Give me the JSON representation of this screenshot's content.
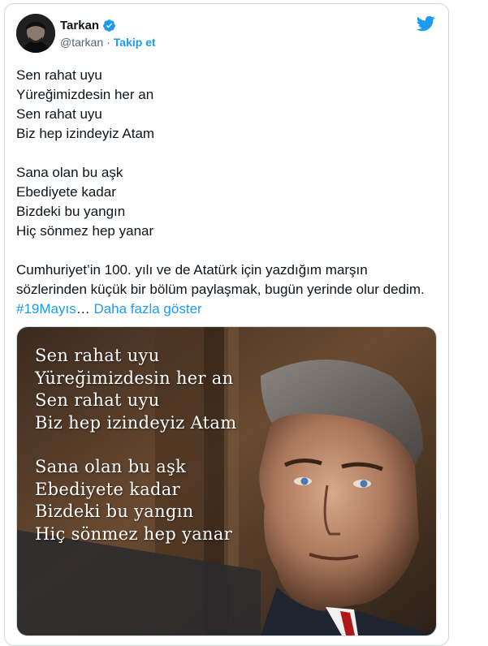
{
  "tweet": {
    "author": {
      "name": "Tarkan",
      "handle": "@tarkan",
      "separator": "·",
      "follow_label": "Takip et",
      "verified": true
    },
    "body": {
      "stanza1": [
        "Sen rahat uyu",
        "Yüreğimizdesin her an",
        "Sen rahat uyu",
        "Biz hep izindeyiz Atam"
      ],
      "stanza2": [
        "Sana olan bu aşk",
        "Ebediyete kadar",
        "Bizdeki bu yangın",
        "Hiç sönmez hep yanar"
      ],
      "paragraph_text": "Cumhuriyet’in 100. yılı ve de Atatürk için yazdığım marşın sözlerinden küçük bir bölüm paylaşmak, bugün yerinde olur dedim. ",
      "hashtag": "#19Mayıs",
      "ellipsis": "…",
      "show_more": "Daha fazla göster"
    },
    "media": {
      "overlay_stanza1": [
        "Sen rahat uyu",
        "Yüreğimizdesin her an",
        "Sen rahat uyu",
        "Biz hep izindeyiz Atam"
      ],
      "overlay_stanza2": [
        "Sana olan bu aşk",
        "Ebediyete kadar",
        "Bizdeki bu yangın",
        "Hiç sönmez hep yanar"
      ]
    },
    "icons": {
      "brand": "twitter-bird-icon",
      "badge": "verified-badge-icon"
    },
    "colors": {
      "accent": "#1d9bf0",
      "text": "#0f1419",
      "muted": "#536471",
      "border": "#cfd9de"
    }
  }
}
